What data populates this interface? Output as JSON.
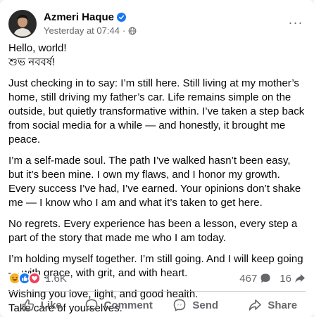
{
  "post": {
    "author": "Azmeri Haque",
    "timestamp": "Yesterday at 07:44",
    "separator": "·",
    "more_label": "···",
    "greeting": "Hello, world!",
    "greeting_bengali": "শুভ নববর্ষ!",
    "paragraphs": [
      "Just checking in to say: I’m still here. Still living at my mother’s home, still driving my father’s car. Life remains simple on the outside, but quietly transformative within. I’ve taken a step back from social media for a while — and honestly, it brought me peace.",
      "I’m a self-made soul. The path I’ve walked hasn’t been easy, but it’s been mine. I own my flaws, and I honor my growth. Every success I’ve had, I’ve earned. Your opinions don’t shake me — I know who I am and what it’s taken to get here.",
      "No regrets. Every experience has been a lesson, every step a part of the story that made me who I am today.",
      "I’m holding myself together. I’m still going. And I will keep going — with grace, with grit, and with heart."
    ],
    "closing_1": "Wishing you love, light, and good health.",
    "closing_2": "Take care of yourselves."
  },
  "reactions": {
    "icons": [
      "haha-icon",
      "like-icon",
      "love-icon"
    ],
    "count": "1.6K",
    "comments": "467",
    "shares": "16"
  },
  "actions": {
    "like": "Like",
    "comment": "Comment",
    "send": "Send",
    "share": "Share"
  },
  "colors": {
    "verified": "#1877f2",
    "secondary_text": "#65676b",
    "like_blue": "#1877f2",
    "love_red": "#f33e58",
    "haha_yellow": "#f7b125"
  }
}
